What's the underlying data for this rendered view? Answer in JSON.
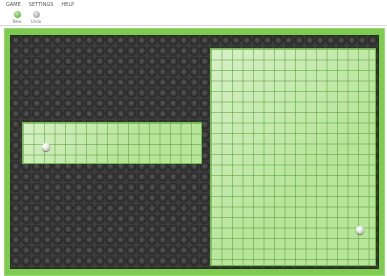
{
  "menu": {
    "items": [
      "GAME",
      "SETTINGS",
      "HELP"
    ]
  },
  "toolbar": {
    "new_label": "New",
    "undo_label": "Undo"
  },
  "board": {
    "accent_color": "#7ccd4a",
    "filled_color": "#b7e59a",
    "cell_color": "#3c3c3c",
    "ball_count": 2
  }
}
